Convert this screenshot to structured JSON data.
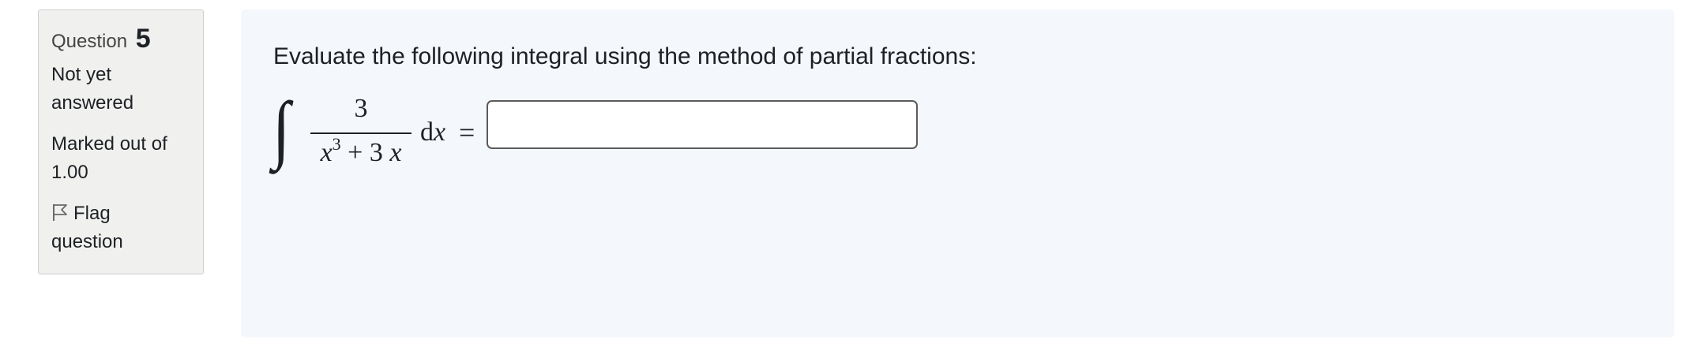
{
  "info_panel": {
    "question_label": "Question",
    "question_number": "5",
    "state_line1": "Not yet",
    "state_line2": "answered",
    "grade_line1": "Marked out of",
    "grade_line2": "1.00",
    "flag_line1": "Flag",
    "flag_line2": "question",
    "flag_icon": "flag-outline-icon"
  },
  "question": {
    "text": "Evaluate the following integral using the method of partial fractions:",
    "formula": {
      "integral_sign": "∫",
      "numerator": "3",
      "denominator_x": "x",
      "denominator_exp": "3",
      "denominator_rest": " + 3",
      "denominator_x2": "x",
      "differential_d": "d",
      "differential_var": "x",
      "equals": "="
    },
    "answer_value": ""
  },
  "colors": {
    "info_bg": "#f0f0ee",
    "content_bg": "#f4f7fc",
    "text": "#1d2125"
  }
}
